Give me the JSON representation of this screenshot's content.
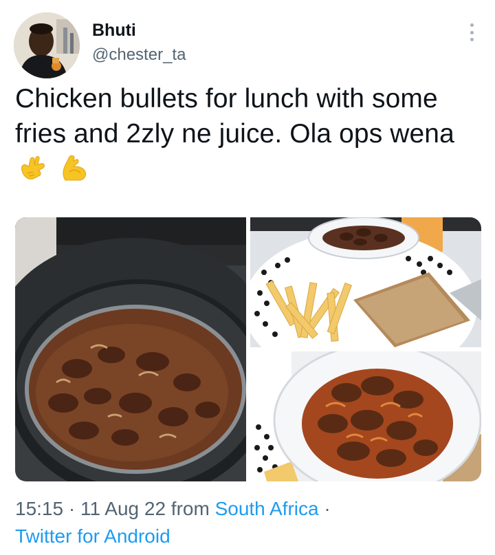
{
  "author": {
    "display_name": "Bhuti",
    "handle": "@chester_ta"
  },
  "tweet": {
    "text": "Chicken bullets for lunch with some fries and 2zly ne juice. Ola ops wena",
    "emojis": [
      "call-me-hand-emoji",
      "flexed-biceps-emoji"
    ]
  },
  "media": {
    "images": [
      "pot-of-chicken-gizzards-photo",
      "plate-with-fries-bread-and-bowl-photo",
      "bowl-of-chicken-gizzards-closeup-photo"
    ]
  },
  "meta": {
    "time": "15:15",
    "sep1": " · ",
    "date": "11 Aug 22",
    "from_text": " from ",
    "location": "South Africa",
    "sep2": " ·",
    "client": "Twitter for Android"
  },
  "colors": {
    "text": "#0f1419",
    "secondary": "#536471",
    "link": "#1d9bf0"
  }
}
